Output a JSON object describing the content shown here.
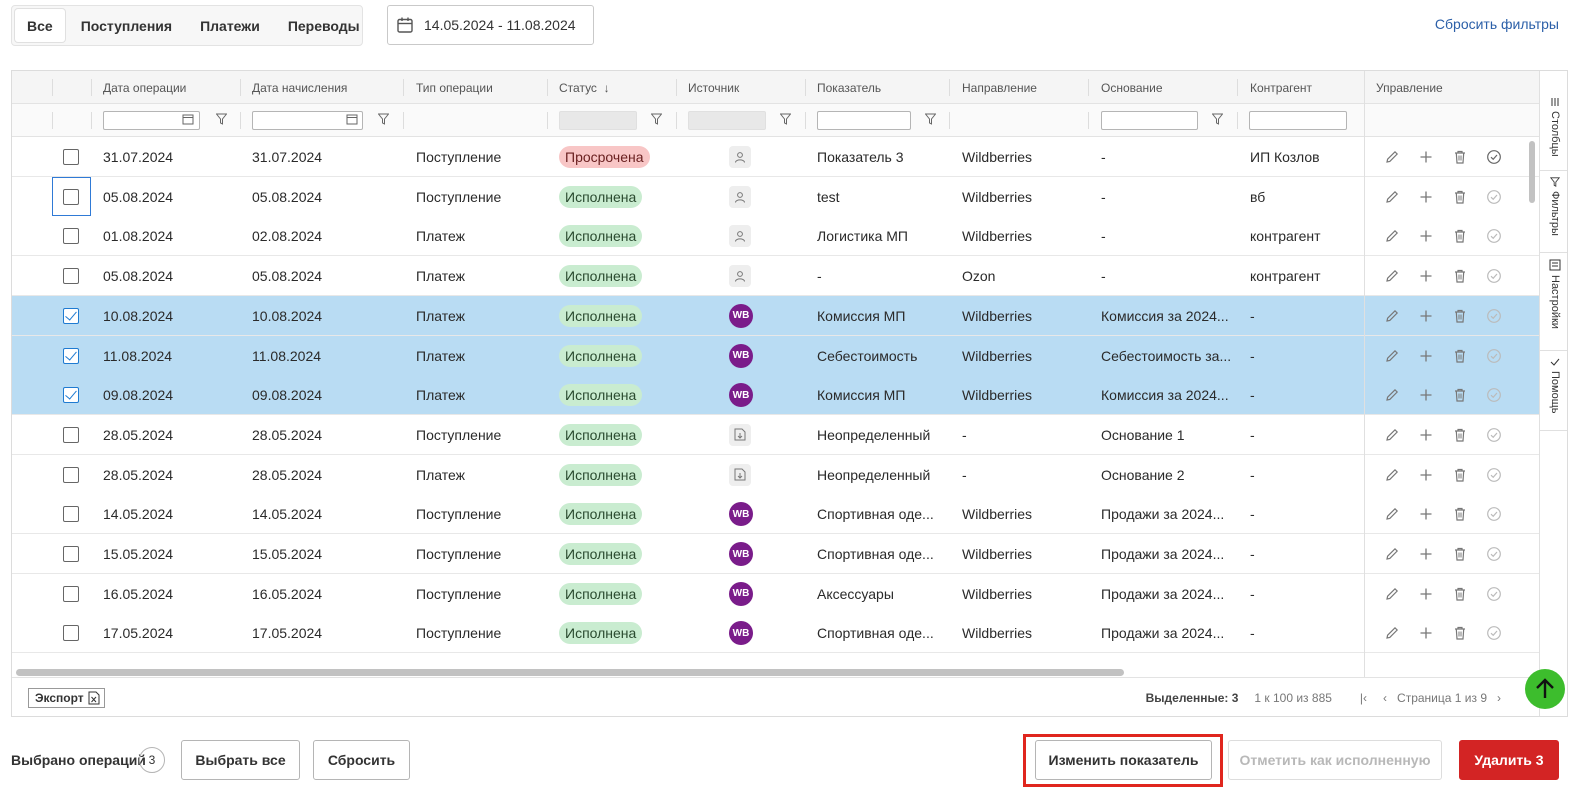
{
  "tabs": [
    "Все",
    "Поступления",
    "Платежи",
    "Переводы"
  ],
  "date_range": "14.05.2024 - 11.08.2024",
  "reset_filters": "Сбросить фильтры",
  "columns": [
    "Дата операции",
    "Дата начисления",
    "Тип операции",
    "Статус",
    "Источник",
    "Показатель",
    "Направление",
    "Основание",
    "Контрагент",
    "Управление"
  ],
  "sort_indicator": "↓",
  "rows": [
    {
      "op_date": "31.07.2024",
      "acc_date": "31.07.2024",
      "type": "Поступление",
      "status": "Просрочена",
      "status_kind": "late",
      "source": "person",
      "metric": "Показатель 3",
      "direction": "Wildberries",
      "basis": "-",
      "counterparty": "ИП Козлов",
      "checked": false
    },
    {
      "op_date": "05.08.2024",
      "acc_date": "05.08.2024",
      "type": "Поступление",
      "status": "Исполнена",
      "status_kind": "ok",
      "source": "person",
      "metric": "test",
      "direction": "Wildberries",
      "basis": "-",
      "counterparty": "вб",
      "checked": false
    },
    {
      "op_date": "01.08.2024",
      "acc_date": "02.08.2024",
      "type": "Платеж",
      "status": "Исполнена",
      "status_kind": "ok",
      "source": "person",
      "metric": "Логистика МП",
      "direction": "Wildberries",
      "basis": "-",
      "counterparty": "контрагент",
      "checked": false
    },
    {
      "op_date": "05.08.2024",
      "acc_date": "05.08.2024",
      "type": "Платеж",
      "status": "Исполнена",
      "status_kind": "ok",
      "source": "person",
      "metric": "-",
      "direction": "Ozon",
      "basis": "-",
      "counterparty": "контрагент",
      "checked": false
    },
    {
      "op_date": "10.08.2024",
      "acc_date": "10.08.2024",
      "type": "Платеж",
      "status": "Исполнена",
      "status_kind": "ok",
      "source": "wb",
      "metric": "Комиссия МП",
      "direction": "Wildberries",
      "basis": "Комиссия за 2024...",
      "counterparty": "-",
      "checked": true
    },
    {
      "op_date": "11.08.2024",
      "acc_date": "11.08.2024",
      "type": "Платеж",
      "status": "Исполнена",
      "status_kind": "ok",
      "source": "wb",
      "metric": "Себестоимость",
      "direction": "Wildberries",
      "basis": "Себестоимость за...",
      "counterparty": "-",
      "checked": true
    },
    {
      "op_date": "09.08.2024",
      "acc_date": "09.08.2024",
      "type": "Платеж",
      "status": "Исполнена",
      "status_kind": "ok",
      "source": "wb",
      "metric": "Комиссия МП",
      "direction": "Wildberries",
      "basis": "Комиссия за 2024...",
      "counterparty": "-",
      "checked": true
    },
    {
      "op_date": "28.05.2024",
      "acc_date": "28.05.2024",
      "type": "Поступление",
      "status": "Исполнена",
      "status_kind": "ok",
      "source": "doc",
      "metric": "Неопределенный",
      "direction": "-",
      "basis": "Основание 1",
      "counterparty": "-",
      "checked": false
    },
    {
      "op_date": "28.05.2024",
      "acc_date": "28.05.2024",
      "type": "Платеж",
      "status": "Исполнена",
      "status_kind": "ok",
      "source": "doc",
      "metric": "Неопределенный",
      "direction": "-",
      "basis": "Основание 2",
      "counterparty": "-",
      "checked": false
    },
    {
      "op_date": "14.05.2024",
      "acc_date": "14.05.2024",
      "type": "Поступление",
      "status": "Исполнена",
      "status_kind": "ok",
      "source": "wb",
      "metric": "Спортивная оде...",
      "direction": "Wildberries",
      "basis": "Продажи за 2024...",
      "counterparty": "-",
      "checked": false
    },
    {
      "op_date": "15.05.2024",
      "acc_date": "15.05.2024",
      "type": "Поступление",
      "status": "Исполнена",
      "status_kind": "ok",
      "source": "wb",
      "metric": "Спортивная оде...",
      "direction": "Wildberries",
      "basis": "Продажи за 2024...",
      "counterparty": "-",
      "checked": false
    },
    {
      "op_date": "16.05.2024",
      "acc_date": "16.05.2024",
      "type": "Поступление",
      "status": "Исполнена",
      "status_kind": "ok",
      "source": "wb",
      "metric": "Аксессуары",
      "direction": "Wildberries",
      "basis": "Продажи за 2024...",
      "counterparty": "-",
      "checked": false
    },
    {
      "op_date": "17.05.2024",
      "acc_date": "17.05.2024",
      "type": "Поступление",
      "status": "Исполнена",
      "status_kind": "ok",
      "source": "wb",
      "metric": "Спортивная оде...",
      "direction": "Wildberries",
      "basis": "Продажи за 2024...",
      "counterparty": "-",
      "checked": false
    }
  ],
  "wb_label": "WB",
  "side_tabs": [
    "Столбцы",
    "Фильтры",
    "Настройки",
    "Помощь"
  ],
  "export_label": "Экспорт",
  "pager": {
    "selected": "Выделенные: 3",
    "range": "1 к 100 из 885",
    "page": "Страница 1 из 9"
  },
  "bottom": {
    "selected_label": "Выбрано операций",
    "selected_count": "3",
    "select_all": "Выбрать все",
    "reset": "Сбросить",
    "change_metric": "Изменить показатель",
    "mark_done": "Отметить как исполненную",
    "delete": "Удалить 3"
  },
  "colors": {
    "accent": "#2b5fa8",
    "selected_row": "#b9dcf3",
    "ok_badge": "#c9ecd0",
    "late_badge": "#f8c6c6",
    "wb": "#7a1c8a",
    "danger": "#d32424",
    "up": "#3dbd2d"
  }
}
